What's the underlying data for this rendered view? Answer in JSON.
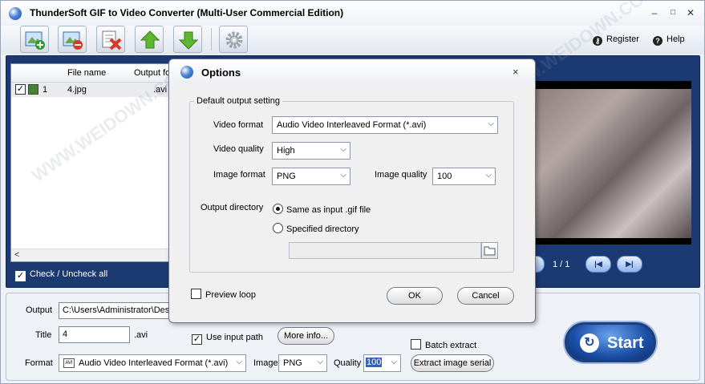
{
  "app": {
    "title": "ThunderSoft GIF to Video Converter (Multi-User Commercial Edition)",
    "window_controls": [
      "–",
      "□",
      "✕"
    ]
  },
  "toolbar": {
    "buttons": [
      "add-file-icon",
      "remove-file-icon",
      "clear-list-icon",
      "move-up-icon",
      "move-down-icon",
      "settings-gear-icon"
    ],
    "register_label": "Register",
    "help_label": "Help"
  },
  "file_list": {
    "columns": [
      "File name",
      "Output fo"
    ],
    "rows": [
      {
        "index": "1",
        "file_name": "4.jpg",
        "output": ".avi",
        "checked": true
      }
    ],
    "scroll_left": "<",
    "check_all_label": "Check / Uncheck all"
  },
  "preview": {
    "pager": "1 / 1"
  },
  "bottom": {
    "output_label": "Output",
    "output_value": "C:\\Users\\Administrator\\Desk",
    "title_label": "Title",
    "title_value": "4",
    "title_ext": ".avi",
    "use_input_path_label": "Use input path",
    "more_info_label": "More info...",
    "batch_extract_label": "Batch extract",
    "format_label": "Format",
    "format_value": "Audio Video Interleaved Format (*.avi)",
    "image_label": "Image",
    "image_value": "PNG",
    "quality_label": "Quality",
    "quality_value": "100",
    "extract_serial_label": "Extract image serial",
    "start_label": "Start"
  },
  "dialog": {
    "title": "Options",
    "close": "×",
    "group_title": "Default output setting",
    "video_format_label": "Video format",
    "video_format_value": "Audio Video Interleaved Format (*.avi)",
    "video_quality_label": "Video quality",
    "video_quality_value": "High",
    "image_format_label": "Image format",
    "image_format_value": "PNG",
    "image_quality_label": "Image quality",
    "image_quality_value": "100",
    "output_directory_label": "Output directory",
    "same_as_input_label": "Same as input .gif file",
    "specified_directory_label": "Specified directory",
    "directory_value": "",
    "preview_loop_label": "Preview loop",
    "ok_label": "OK",
    "cancel_label": "Cancel"
  },
  "watermark": "WWW.WEIDOWN.COM",
  "colors": {
    "work_area": "#1c3a72",
    "start_button": "#1b4fa6"
  }
}
